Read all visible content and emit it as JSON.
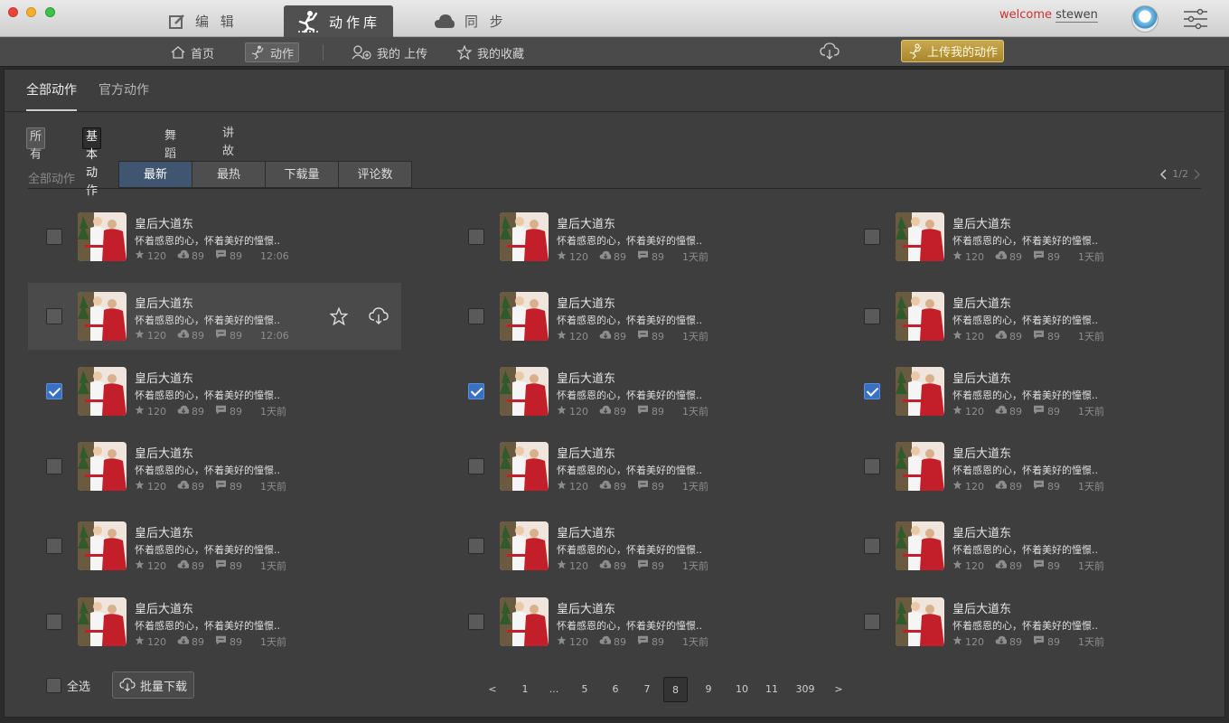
{
  "titlebar": {
    "tabs": [
      {
        "label": "编 辑",
        "icon": "edit-icon"
      },
      {
        "label": "动作库",
        "icon": "dance-figure-icon"
      },
      {
        "label": "同 步",
        "icon": "cloud-icon"
      }
    ],
    "welcome_label": "welcome",
    "username": "stewen"
  },
  "subnav": {
    "home": "首页",
    "action": "动作",
    "my_upload": "我的 上传",
    "my_favorites": "我的收藏",
    "upload_mine": "上传我的动作"
  },
  "main": {
    "tabs": [
      "全部动作",
      "官方动作"
    ],
    "filters": [
      "所有",
      "基本动作",
      "舞蹈",
      "讲故事"
    ],
    "sort_label": "全部动作",
    "sort_buttons": [
      "最新",
      "最热",
      "下载量",
      "评论数"
    ],
    "page_indicator": "1/2"
  },
  "cards": [
    {
      "title": "皇后大道东",
      "desc": "怀着感恩的心，怀着美好的憧憬..",
      "stars": "120",
      "downloads": "89",
      "comments": "89",
      "time": "12:06",
      "checked": false
    },
    {
      "title": "皇后大道东",
      "desc": "怀着感恩的心，怀着美好的憧憬..",
      "stars": "120",
      "downloads": "89",
      "comments": "89",
      "time": "1天前",
      "checked": false
    },
    {
      "title": "皇后大道东",
      "desc": "怀着感恩的心，怀着美好的憧憬..",
      "stars": "120",
      "downloads": "89",
      "comments": "89",
      "time": "1天前",
      "checked": false
    },
    {
      "title": "皇后大道东",
      "desc": "怀着感恩的心，怀着美好的憧憬..",
      "stars": "120",
      "downloads": "89",
      "comments": "89",
      "time": "12:06",
      "checked": false
    },
    {
      "title": "皇后大道东",
      "desc": "怀着感恩的心，怀着美好的憧憬..",
      "stars": "120",
      "downloads": "89",
      "comments": "89",
      "time": "1天前",
      "checked": false
    },
    {
      "title": "皇后大道东",
      "desc": "怀着感恩的心，怀着美好的憧憬..",
      "stars": "120",
      "downloads": "89",
      "comments": "89",
      "time": "1天前",
      "checked": false
    },
    {
      "title": "皇后大道东",
      "desc": "怀着感恩的心，怀着美好的憧憬..",
      "stars": "120",
      "downloads": "89",
      "comments": "89",
      "time": "1天前",
      "checked": true
    },
    {
      "title": "皇后大道东",
      "desc": "怀着感恩的心，怀着美好的憧憬..",
      "stars": "120",
      "downloads": "89",
      "comments": "89",
      "time": "1天前",
      "checked": true
    },
    {
      "title": "皇后大道东",
      "desc": "怀着感恩的心，怀着美好的憧憬..",
      "stars": "120",
      "downloads": "89",
      "comments": "89",
      "time": "1天前",
      "checked": true
    },
    {
      "title": "皇后大道东",
      "desc": "怀着感恩的心，怀着美好的憧憬..",
      "stars": "120",
      "downloads": "89",
      "comments": "89",
      "time": "1天前",
      "checked": false
    },
    {
      "title": "皇后大道东",
      "desc": "怀着感恩的心，怀着美好的憧憬..",
      "stars": "120",
      "downloads": "89",
      "comments": "89",
      "time": "1天前",
      "checked": false
    },
    {
      "title": "皇后大道东",
      "desc": "怀着感恩的心，怀着美好的憧憬..",
      "stars": "120",
      "downloads": "89",
      "comments": "89",
      "time": "1天前",
      "checked": false
    },
    {
      "title": "皇后大道东",
      "desc": "怀着感恩的心，怀着美好的憧憬..",
      "stars": "120",
      "downloads": "89",
      "comments": "89",
      "time": "1天前",
      "checked": false
    },
    {
      "title": "皇后大道东",
      "desc": "怀着感恩的心，怀着美好的憧憬..",
      "stars": "120",
      "downloads": "89",
      "comments": "89",
      "time": "1天前",
      "checked": false
    },
    {
      "title": "皇后大道东",
      "desc": "怀着感恩的心，怀着美好的憧憬..",
      "stars": "120",
      "downloads": "89",
      "comments": "89",
      "time": "1天前",
      "checked": false
    },
    {
      "title": "皇后大道东",
      "desc": "怀着感恩的心，怀着美好的憧憬..",
      "stars": "120",
      "downloads": "89",
      "comments": "89",
      "time": "1天前",
      "checked": false
    },
    {
      "title": "皇后大道东",
      "desc": "怀着感恩的心，怀着美好的憧憬..",
      "stars": "120",
      "downloads": "89",
      "comments": "89",
      "time": "1天前",
      "checked": false
    },
    {
      "title": "皇后大道东",
      "desc": "怀着感恩的心，怀着美好的憧憬..",
      "stars": "120",
      "downloads": "89",
      "comments": "89",
      "time": "1天前",
      "checked": false
    }
  ],
  "footer": {
    "select_all": "全选",
    "batch_download": "批量下载",
    "pages": [
      "<",
      "1",
      "...",
      "5",
      "6",
      "7",
      "8",
      "9",
      "10",
      "11",
      "309",
      ">"
    ],
    "current_page": "8"
  },
  "colors": {
    "accent_blue": "#3f5570",
    "checkbox_blue": "#3a70c2",
    "upload_gold": "#b8973e",
    "welcome_red": "#c8322f"
  }
}
